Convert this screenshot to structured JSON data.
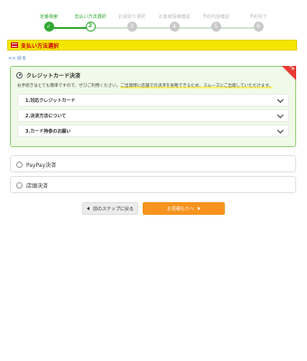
{
  "steps": [
    {
      "label": "定番検索",
      "number": "✓",
      "state": "done"
    },
    {
      "label": "支払い方法選択",
      "number": "2",
      "state": "current"
    },
    {
      "label": "お受取り選択",
      "number": "3",
      "state": "todo"
    },
    {
      "label": "お客様情報確認",
      "number": "4",
      "state": "todo"
    },
    {
      "label": "予約内容確認",
      "number": "5",
      "state": "todo"
    },
    {
      "label": "予約完了",
      "number": "6",
      "state": "todo"
    }
  ],
  "section_title": "支払い方法選択",
  "back_link": "<< 戻る",
  "credit": {
    "title": "クレジットカード決済",
    "ribbon": "おすすめ",
    "desc_plain": "お手続きはとても簡単ですので、ぜひご利用ください。",
    "desc_highlight": "ご出発時に店舗での決済を省略できるため、スムーズにご出発していただけます。",
    "accordions": [
      "1.対応クレジットカード",
      "2.決済方法について",
      "3.カード持参のお願い"
    ]
  },
  "paypay": {
    "title": "PayPay決済"
  },
  "store": {
    "title": "店頭決済"
  },
  "buttons": {
    "back": "前のステップに戻る",
    "next": "お見積もりへ"
  }
}
